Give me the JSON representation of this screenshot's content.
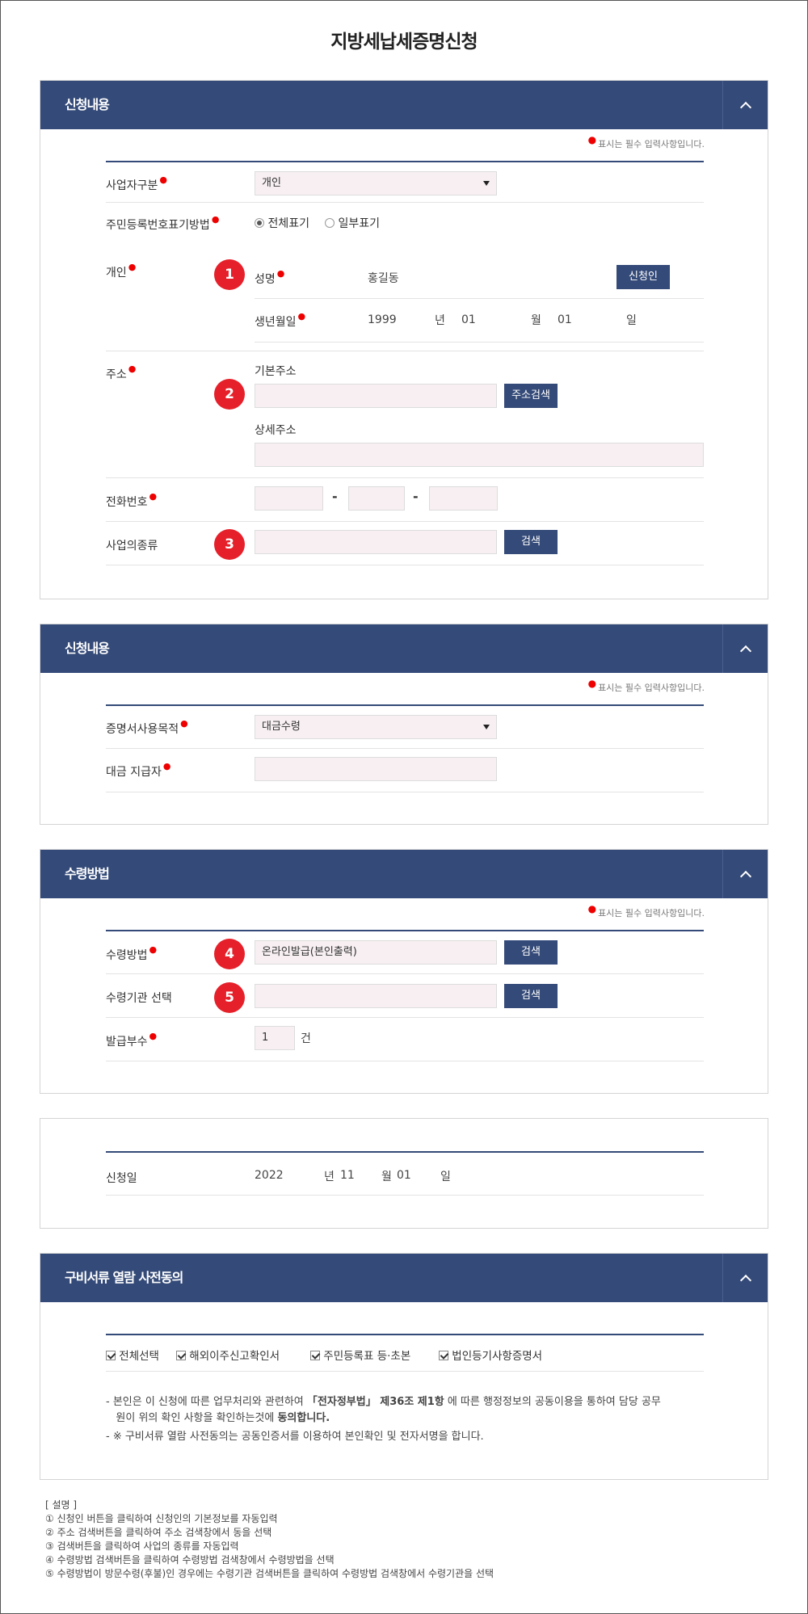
{
  "title": "지방세납세증명신청",
  "required_note": "표시는 필수 입력사항입니다.",
  "toggle_icon": "chevron-up-icon",
  "section1": {
    "title": "신청내용",
    "business_type_label": "사업자구분",
    "business_type_value": "개인",
    "rrn_display_label": "주민등록번호표기방법",
    "rrn_options": [
      "전체표기",
      "일부표기"
    ],
    "rrn_selected": "전체표기",
    "individual_label": "개인",
    "badges": [
      "1",
      "2",
      "3"
    ],
    "name_label": "성명",
    "name_value": "홍길동",
    "applicant_button": "신청인",
    "birth_label": "생년월일",
    "birth_year": "1999",
    "birth_year_unit": "년",
    "birth_month": "01",
    "birth_month_unit": "월",
    "birth_day": "01",
    "birth_day_unit": "일",
    "address_label": "주소",
    "basic_address_label": "기본주소",
    "address_search_button": "주소검색",
    "detail_address_label": "상세주소",
    "phone_label": "전화번호",
    "phone_sep": "-",
    "business_kind_label": "사업의종류",
    "search_button": "검색"
  },
  "section2": {
    "title": "신청내용",
    "purpose_label": "증명서사용목적",
    "purpose_value": "대금수령",
    "payer_label": "대금 지급자"
  },
  "section3": {
    "title": "수령방법",
    "badges": [
      "4",
      "5"
    ],
    "method_label": "수령방법",
    "method_value": "온라인발급(본인출력)",
    "org_label": "수령기관 선택",
    "search_button": "검색",
    "copies_label": "발급부수",
    "copies_value": "1",
    "copies_unit": "건"
  },
  "section4": {
    "date_label": "신청일",
    "year": "2022",
    "year_unit": "년",
    "month": "11",
    "month_unit": "월",
    "day": "01",
    "day_unit": "일"
  },
  "section5": {
    "title": "구비서류 열람 사전동의",
    "checkboxes": [
      "전체선택",
      "해외이주신고확인서",
      "주민등록표 등·초본",
      "법인등기사항증명서"
    ],
    "note1_a": "- 본인은 이 신청에 따른 업무처리와 관련하여 ",
    "note1_b": "「전자정부법」 제36조 제1항",
    "note1_c": " 에 따른 행정정보의 공동이용을 통하여 담당 공무",
    "note1_d": "원이 위의 확인 사항을 확인하는것에 ",
    "note1_e": "동의합니다.",
    "note2": "- ※ 구비서류 열람 사전동의는 공동인증서를 이용하여 본인확인 및 전자서명을 합니다."
  },
  "legend": {
    "title": "[ 설명 ]",
    "items": [
      "① 신청인 버튼을 클릭하여 신청인의 기본정보를 자동입력",
      "② 주소 검색버튼을 클릭하여 주소 검색창에서 동을 선택",
      "③ 검색버튼을 클릭하여 사업의 종류를 자동입력",
      "④ 수령방법 검색버튼을 클릭하여 수령방법 검색창에서 수령방법을 선택",
      "⑤ 수령방법이 방문수령(후불)인 경우에는 수령기관 검색버튼을 클릭하여 수령방법 검색창에서 수령기관을 선택"
    ]
  }
}
